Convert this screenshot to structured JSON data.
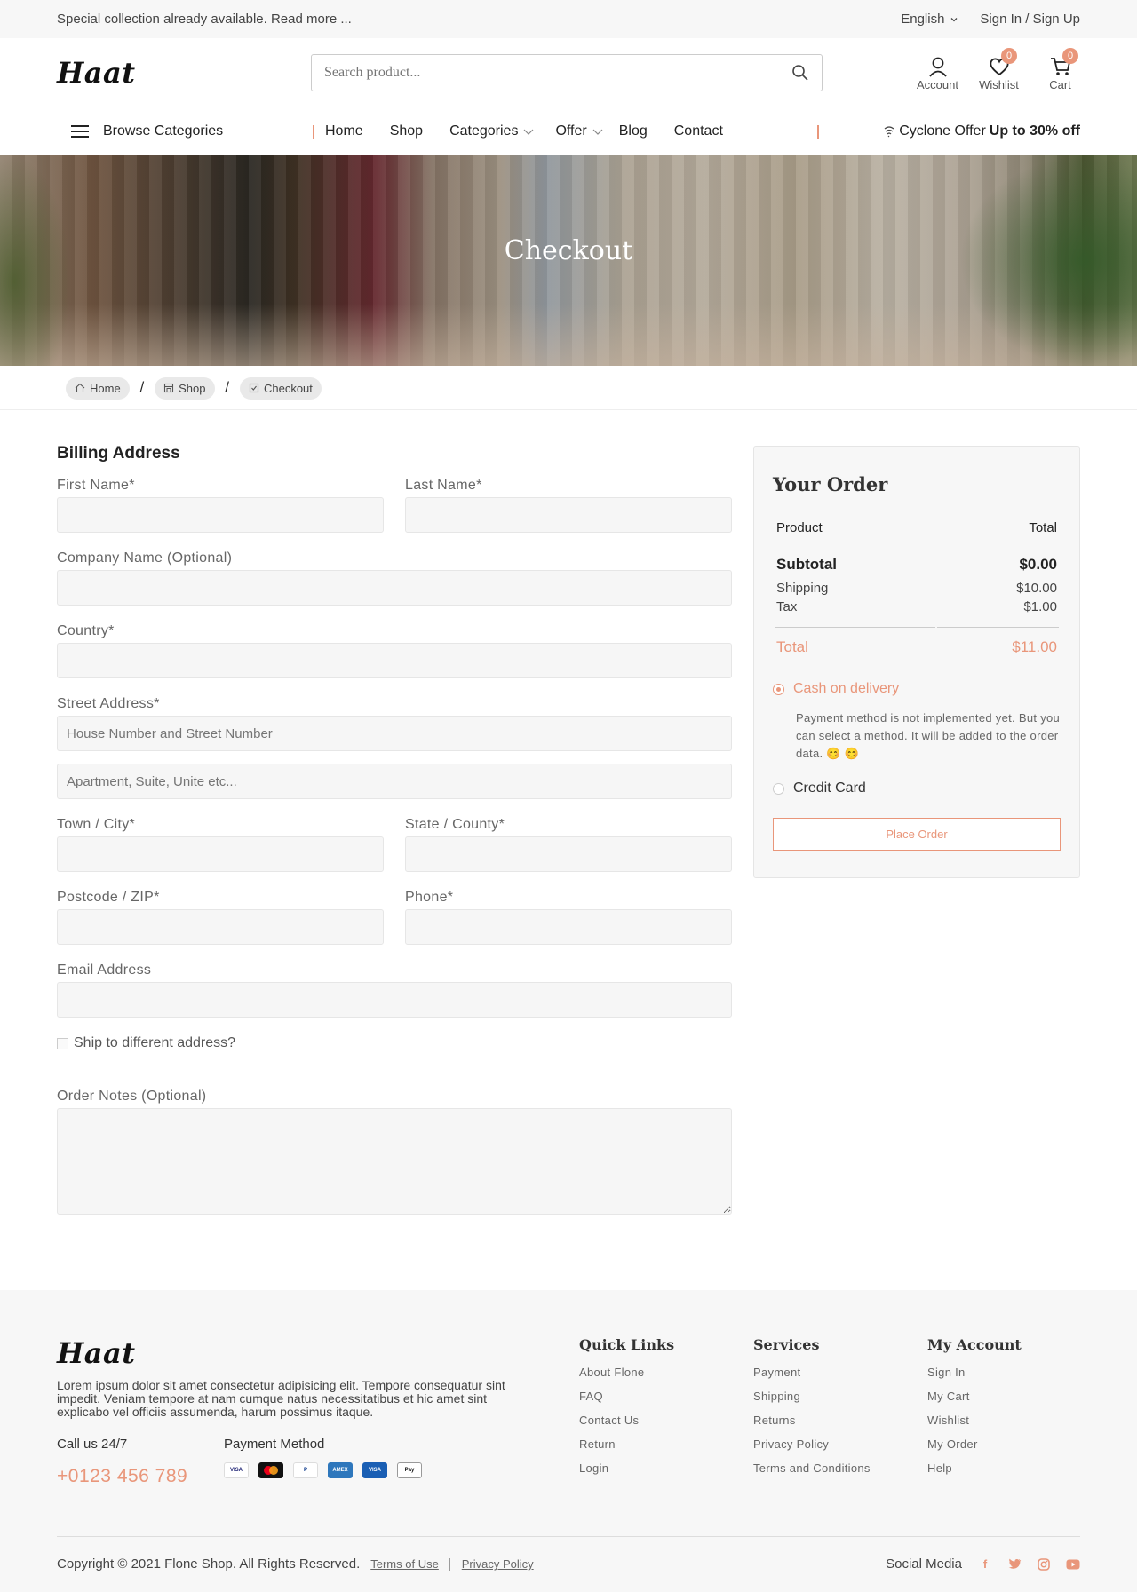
{
  "topbar": {
    "announcement": "Special collection already available. Read more ...",
    "language": "English",
    "auth": "Sign In / Sign Up"
  },
  "header": {
    "logo": "Haat",
    "search_placeholder": "Search product...",
    "account_label": "Account",
    "wishlist_label": "Wishlist",
    "wishlist_count": "0",
    "cart_label": "Cart",
    "cart_count": "0"
  },
  "nav": {
    "browse": "Browse Categories",
    "items": [
      "Home",
      "Shop",
      "Categories",
      "Offer",
      "Blog",
      "Contact"
    ],
    "offer_prefix": "Cyclone Offer",
    "offer_strong": "Up to 30% off"
  },
  "banner": {
    "title": "Checkout"
  },
  "breadcrumb": [
    "Home",
    "Shop",
    "Checkout"
  ],
  "billing": {
    "title": "Billing Address",
    "first_name": "First Name*",
    "last_name": "Last Name*",
    "company": "Company Name (Optional)",
    "country": "Country*",
    "street": "Street Address*",
    "street_ph1": "House Number and Street Number",
    "street_ph2": "Apartment, Suite, Unite etc...",
    "city": "Town / City*",
    "state": "State / County*",
    "postcode": "Postcode / ZIP*",
    "phone": "Phone*",
    "email": "Email Address",
    "ship_different": "Ship to different address?",
    "notes": "Order Notes (Optional)"
  },
  "order": {
    "title": "Your Order",
    "col_product": "Product",
    "col_total": "Total",
    "subtotal_label": "Subtotal",
    "subtotal_value": "$0.00",
    "shipping_label": "Shipping",
    "shipping_value": "$10.00",
    "tax_label": "Tax",
    "tax_value": "$1.00",
    "total_label": "Total",
    "total_value": "$11.00",
    "cod_label": "Cash on delivery",
    "cod_note": "Payment method is not implemented yet. But you can select a method. It will be added to the order data. 😊 😊",
    "cc_label": "Credit Card",
    "place_order": "Place Order"
  },
  "footer": {
    "logo": "Haat",
    "about": "Lorem ipsum dolor sit amet consectetur adipisicing elit. Tempore consequatur sint impedit. Veniam tempore at nam cumque natus necessitatibus et hic amet sint explicabo vel officiis assumenda, harum possimus itaque.",
    "call_label": "Call us 24/7",
    "phone": "+0123 456 789",
    "payment_label": "Payment Method",
    "quick_links_title": "Quick Links",
    "quick_links": [
      "About Flone",
      "FAQ",
      "Contact Us",
      "Return",
      "Login"
    ],
    "services_title": "Services",
    "services": [
      "Payment",
      "Shipping",
      "Returns",
      "Privacy Policy",
      "Terms and Conditions"
    ],
    "account_title": "My Account",
    "account": [
      "Sign In",
      "My Cart",
      "Wishlist",
      "My Order",
      "Help"
    ],
    "copyright": "Copyright © 2021 Flone Shop. All Rights Reserved.",
    "terms": "Terms of Use",
    "privacy": "Privacy Policy",
    "social_label": "Social Media"
  },
  "colors": {
    "accent": "#e9967a"
  }
}
